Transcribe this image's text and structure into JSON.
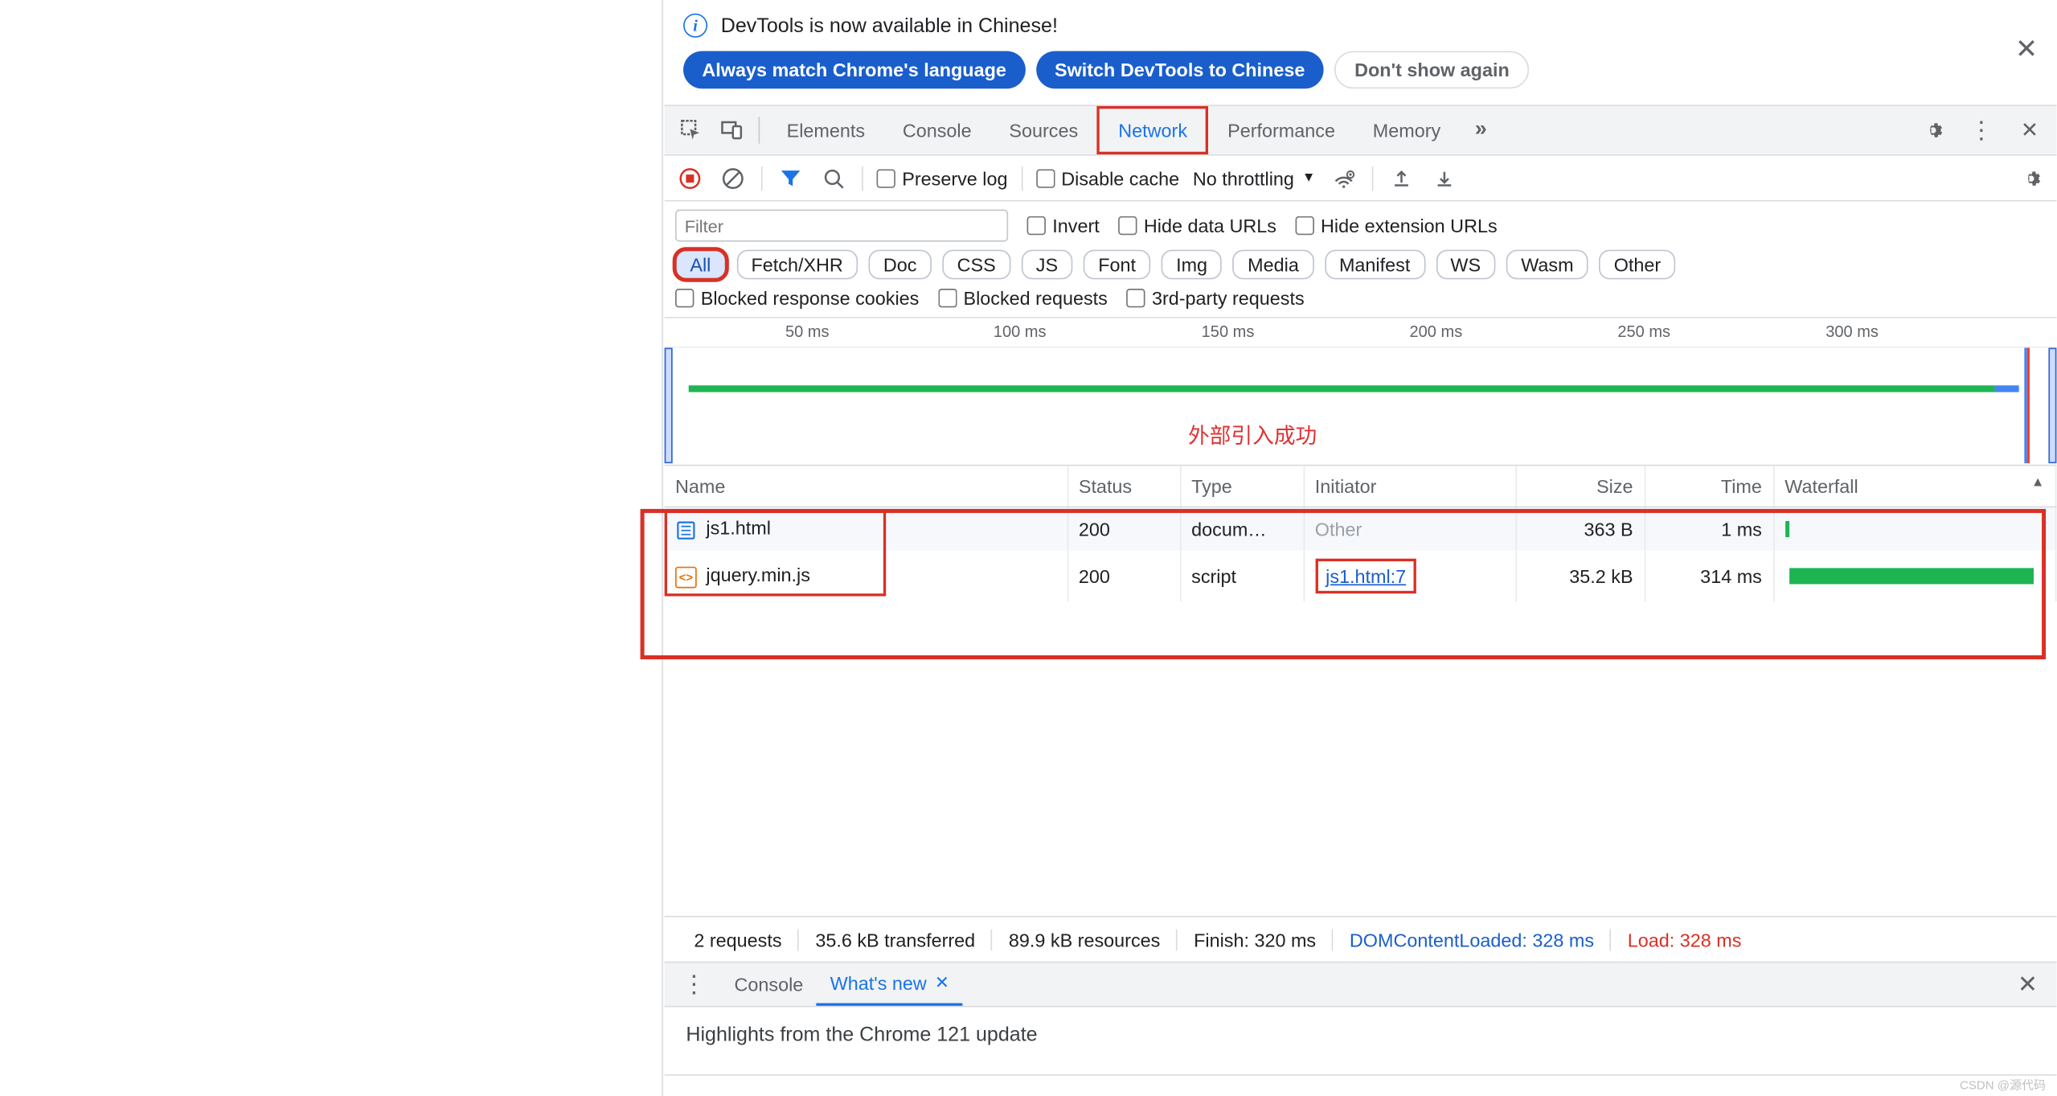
{
  "infoBar": {
    "message": "DevTools is now available in Chinese!",
    "btn1": "Always match Chrome's language",
    "btn2": "Switch DevTools to Chinese",
    "btn3": "Don't show again"
  },
  "tabs": {
    "items": [
      "Elements",
      "Console",
      "Sources",
      "Network",
      "Performance",
      "Memory"
    ],
    "active": "Network"
  },
  "toolbar": {
    "preserveLog": "Preserve log",
    "disableCache": "Disable cache",
    "throttling": "No throttling"
  },
  "filter": {
    "placeholder": "Filter",
    "invert": "Invert",
    "hideData": "Hide data URLs",
    "hideExt": "Hide extension URLs",
    "chips": [
      "All",
      "Fetch/XHR",
      "Doc",
      "CSS",
      "JS",
      "Font",
      "Img",
      "Media",
      "Manifest",
      "WS",
      "Wasm",
      "Other"
    ],
    "activeChip": "All",
    "blockedCookies": "Blocked response cookies",
    "blockedReq": "Blocked requests",
    "thirdParty": "3rd-party requests"
  },
  "timeline": {
    "ticks": [
      "50 ms",
      "100 ms",
      "150 ms",
      "200 ms",
      "250 ms",
      "300 ms"
    ],
    "annotation": "外部引入成功"
  },
  "table": {
    "headers": {
      "name": "Name",
      "status": "Status",
      "type": "Type",
      "initiator": "Initiator",
      "size": "Size",
      "time": "Time",
      "waterfall": "Waterfall"
    },
    "rows": [
      {
        "name": "js1.html",
        "icon": "doc",
        "status": "200",
        "type": "docum…",
        "initiator": "Other",
        "initiatorDim": true,
        "size": "363 B",
        "time": "1 ms",
        "wfStart": 0,
        "wfWidth": 2
      },
      {
        "name": "jquery.min.js",
        "icon": "js",
        "status": "200",
        "type": "script",
        "initiator": "js1.html:7",
        "initiatorBox": true,
        "size": "35.2 kB",
        "time": "314 ms",
        "wfStart": 2,
        "wfWidth": 94
      }
    ]
  },
  "status": {
    "requests": "2 requests",
    "transferred": "35.6 kB transferred",
    "resources": "89.9 kB resources",
    "finish": "Finish: 320 ms",
    "dcl": "DOMContentLoaded: 328 ms",
    "load": "Load: 328 ms"
  },
  "drawer": {
    "tabs": [
      "Console",
      "What's new"
    ],
    "active": "What's new",
    "body": "Highlights from the Chrome 121 update"
  },
  "watermark": "CSDN @源代码"
}
